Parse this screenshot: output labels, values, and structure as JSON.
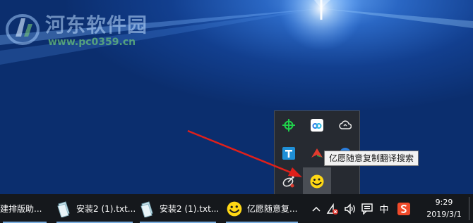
{
  "watermark": {
    "title": "河东软件园",
    "url": "www.pc0359.cn"
  },
  "tray_flyout": {
    "icons": [
      "crosshair-icon",
      "baidu-netdisk-icon",
      "cloud-sync-icon",
      "text-tool-icon",
      "red-arrow-app-icon",
      "blue-circle-app-icon",
      "satellite-icon",
      "translator-icon"
    ]
  },
  "tooltip": {
    "text": "亿愿随意复制翻译搜索"
  },
  "taskbar": {
    "apps": [
      {
        "label": "建排版助...",
        "icon": ""
      },
      {
        "label": "安装2 (1).txt...",
        "icon": "text-file-icon"
      },
      {
        "label": "安装2 (1).txt...",
        "icon": "text-file-icon"
      },
      {
        "label": "亿愿随意复...",
        "icon": "translator-icon"
      }
    ],
    "tray": {
      "chevron": "^",
      "ime_label": "中",
      "icons": [
        "chevron-up-icon",
        "network-error-icon",
        "volume-icon",
        "action-center-icon",
        "sogou-icon"
      ]
    },
    "clock": {
      "time": "9:29",
      "date": "2019/3/1"
    }
  },
  "colors": {
    "taskbar_bg": "#15181c",
    "flyout_bg": "#262a31",
    "accent_underline": "#7aaee0",
    "arrow": "#e0201a",
    "desktop_blue": "#123f8f"
  }
}
